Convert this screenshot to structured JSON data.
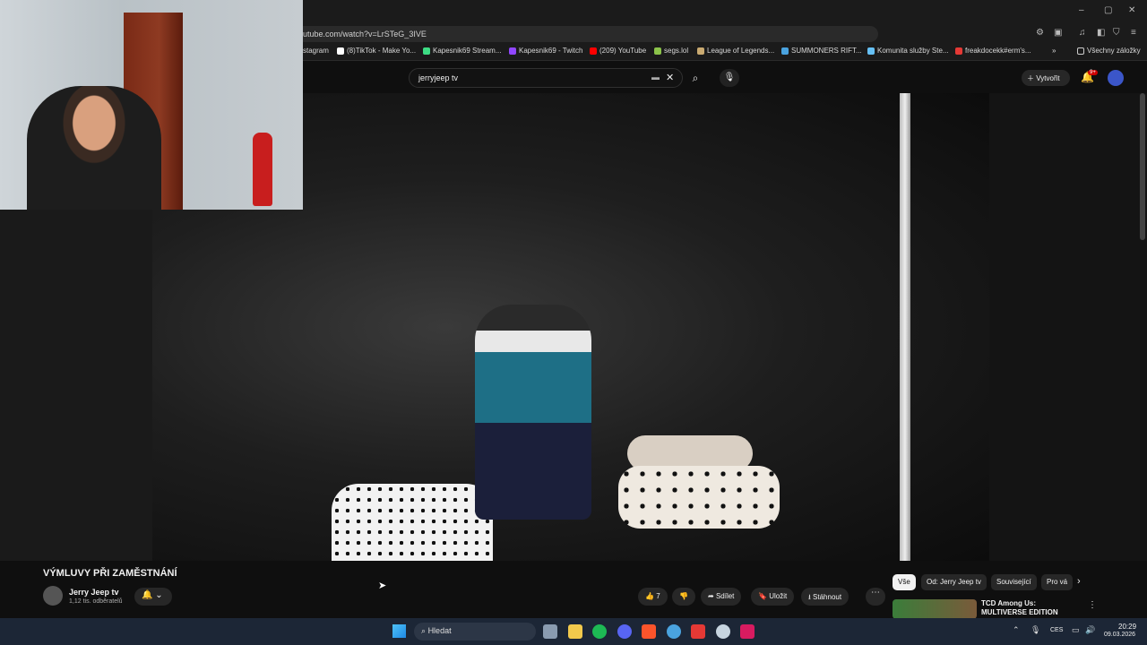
{
  "browser": {
    "url": "utube.com/watch?v=LrSTeG_3IVE",
    "window_controls": [
      "–",
      "▢",
      "✕"
    ],
    "bookmarks": [
      {
        "label": "stagram",
        "color": "#ffffff"
      },
      {
        "label": "(8)TikTok - Make Yo...",
        "color": "#ffffff"
      },
      {
        "label": "Kapesnik69 Stream...",
        "color": "#3ddc84"
      },
      {
        "label": "Kapesnik69 - Twitch",
        "color": "#9146ff"
      },
      {
        "label": "(209) YouTube",
        "color": "#ff0000"
      },
      {
        "label": "segs.lol",
        "color": "#8bc34a"
      },
      {
        "label": "League of Legends...",
        "color": "#c9aa71"
      },
      {
        "label": "SUMMONERS RIFT...",
        "color": "#4aa3df"
      },
      {
        "label": "Komunita služby Ste...",
        "color": "#1b2838"
      },
      {
        "label": "freakdocekk#erm's...",
        "color": "#e53935"
      }
    ],
    "all_bookmarks": "Všechny záložky"
  },
  "youtube": {
    "search_value": "jerryjeep tv",
    "create_label": "Vytvořit",
    "notifications": "9+",
    "video_title": "VÝMLUVY PŘI ZAMĚSTNÁNÍ",
    "channel_name": "Jerry Jeep tv",
    "subscribers": "1,12 tis. odběratelů",
    "likes": "7",
    "share_label": "Sdílet",
    "save_label": "Uložit",
    "download_label": "Stáhnout",
    "chips": [
      "Vše",
      "Od: Jerry Jeep tv",
      "Související",
      "Pro vá"
    ],
    "recommended": {
      "title": "TCD Among Us: MULTIVERSE EDITION"
    }
  },
  "taskbar": {
    "search_placeholder": "Hledat",
    "language": "CES",
    "time": "20:29",
    "date": "09.03.2026",
    "apps": [
      {
        "name": "task-view-icon",
        "color": "#8a9bb0"
      },
      {
        "name": "file-explorer-icon",
        "color": "#f2c94c"
      },
      {
        "name": "spotify-icon",
        "color": "#1db954"
      },
      {
        "name": "discord-icon",
        "color": "#5865f2"
      },
      {
        "name": "brave-icon",
        "color": "#fb542b"
      },
      {
        "name": "app-c-icon",
        "color": "#4aa3df"
      },
      {
        "name": "app-red-icon",
        "color": "#e53935"
      },
      {
        "name": "app-steam-icon",
        "color": "#c7d5e0"
      },
      {
        "name": "app-v-icon",
        "color": "#d81b60"
      }
    ]
  }
}
